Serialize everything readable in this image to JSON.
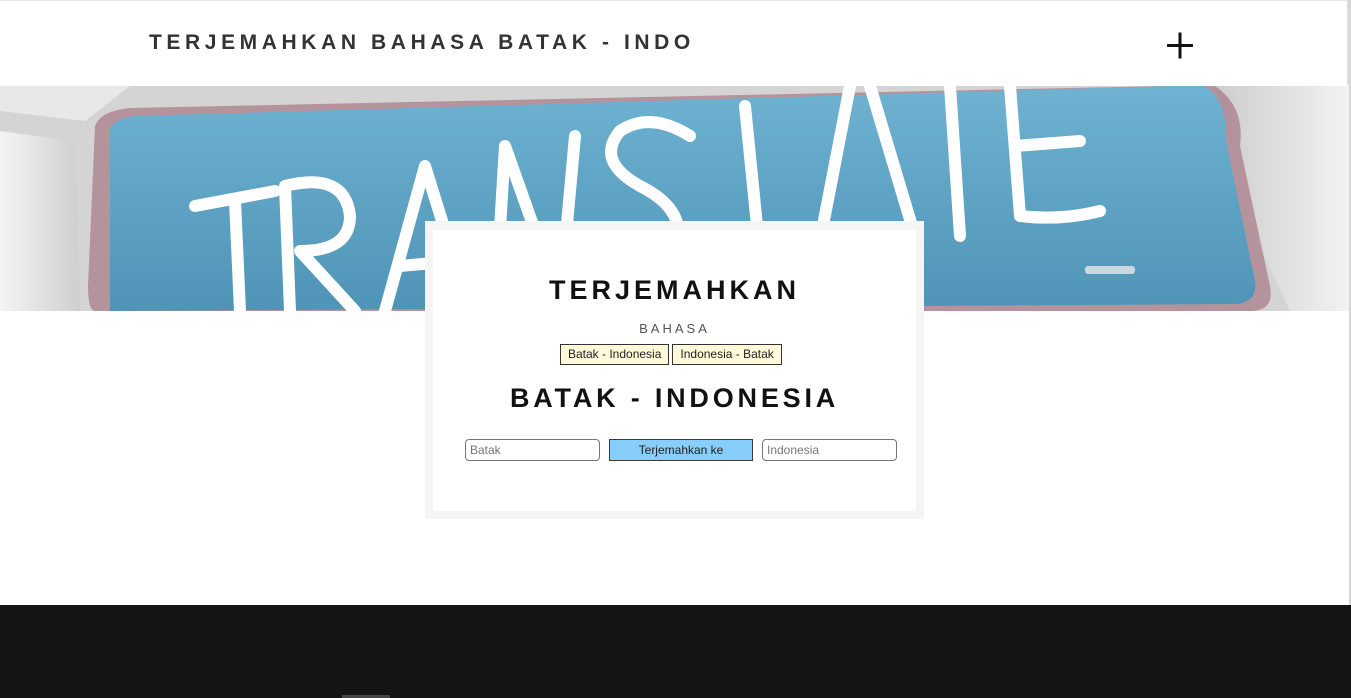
{
  "header": {
    "brand": "TERJEMAHKAN BAHASA BATAK - INDO",
    "menu_icon": "plus-icon"
  },
  "hero": {
    "image_text": "TRANSLATE",
    "description": "keyboard-key-banner-image"
  },
  "card": {
    "title": "TERJEMAHKAN",
    "subtitle": "BAHASA",
    "modes": [
      "Batak - Indonesia",
      "Indonesia - Batak"
    ],
    "direction_title": "BATAK - INDONESIA",
    "source_placeholder": "Batak",
    "translate_label": "Terjemahkan ke",
    "target_placeholder": "Indonesia"
  },
  "colors": {
    "translate_button": "#87cefa",
    "mode_button": "#fff9d9",
    "footer": "#141414",
    "hero_key": "#5ea3c4"
  }
}
